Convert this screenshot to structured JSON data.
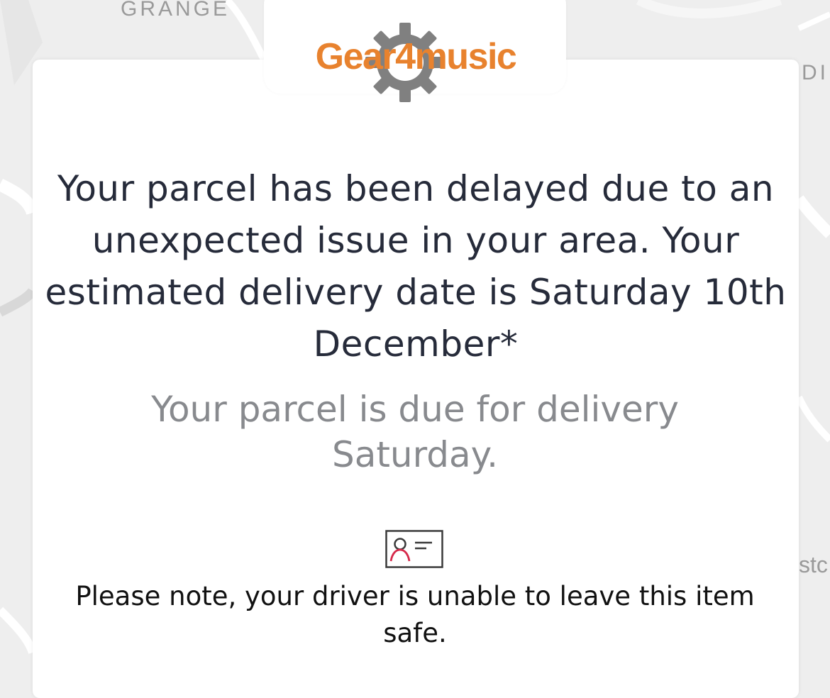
{
  "map": {
    "labels": {
      "grange": "GRANGE",
      "di": "DI",
      "st": "stc"
    }
  },
  "brand": {
    "name": "Gear4music",
    "color": "#e8822e",
    "gear_color": "#808080"
  },
  "message": {
    "headline": "Your parcel has been delayed due to an unexpected issue in your area. Your estimated delivery date is Saturday 10th December*",
    "status": "Your parcel is due for delivery Saturday.",
    "icon": "id-card-icon",
    "note": "Please note, your driver is unable to leave this item safe."
  },
  "colors": {
    "headline": "#262b3a",
    "status": "#888a8e",
    "icon_accent": "#d6294a"
  }
}
